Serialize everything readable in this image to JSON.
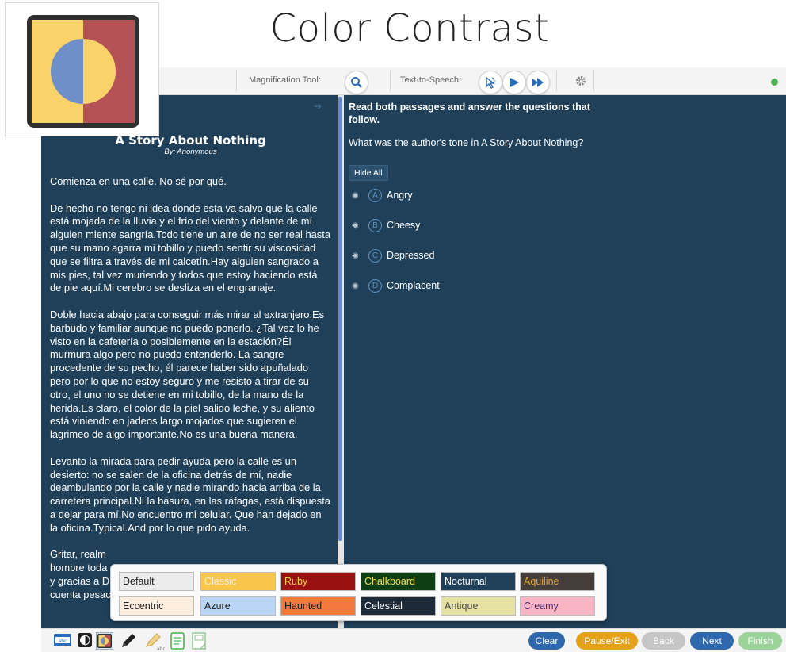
{
  "app": {
    "title": "Color Contrast"
  },
  "toolbar": {
    "magnification_label": "Magnification Tool:",
    "tts_label": "Text-to-Speech:",
    "status_color": "#4caf50"
  },
  "passage": {
    "title": "A Story About Nothing",
    "byline": "By: Anonymous",
    "paragraphs": [
      "Comienza en una calle. No sé por qué.",
      "De hecho no tengo ni idea donde esta va salvo que la calle está mojada de la lluvia y el frío del viento y delante de mí alguien miente sangría.Todo tiene un aire de no ser real hasta que su mano agarra mi tobillo y puedo sentir su viscosidad que se filtra a través de mi calcetín.Hay alguien sangrado a mis pies, tal vez muriendo y todos que estoy haciendo está de pie aquí.Mi cerebro se desliza en el engranaje.",
      "Doble hacia abajo para conseguir más mirar al extranjero.Es barbudo y familiar aunque no puedo ponerlo. ¿Tal vez lo he visto en la cafetería o posiblemente en la estación?Él murmura algo pero no puedo entenderlo. La sangre procedente de su pecho, él parece haber sido apuñalado pero por lo que no estoy seguro y me resisto a tirar de su otro, el uno no se detiene en mi tobillo, de la mano de la herida.Es claro, el color de la piel salido leche, y su aliento está viniendo en jadeos largo mojados que sugieren el lagrimeo de algo importante.No es una buena manera.",
      "Levanto la mirada para pedir ayuda pero la calle es un desierto: no se salen de la oficina detrás de mí, nadie deambulando por la calle y nadie mirando hacia arriba de la carretera principal.Ni la basura, en las ráfagas, está dispuesta a dejar para mí.No encuentro mi celular. Que han dejado en la oficina.Typical.And por lo que pido ayuda.",
      "Gritar, realm",
      "hombre toda",
      "y gracias a D",
      "cuenta pesac"
    ]
  },
  "question": {
    "heading": "Read both passages and answer the questions that follow.",
    "text": "What was the author's tone in A Story About Nothing?",
    "hide_all_label": "Hide All",
    "options": [
      {
        "letter": "A",
        "label": "Angry"
      },
      {
        "letter": "B",
        "label": "Cheesy"
      },
      {
        "letter": "C",
        "label": "Depressed"
      },
      {
        "letter": "D",
        "label": "Complacent"
      }
    ]
  },
  "palette": {
    "swatches": [
      {
        "label": "Default",
        "bg": "#ececec",
        "fg": "#222222"
      },
      {
        "label": "Classic",
        "bg": "#f7c64a",
        "fg": "#f2efe0"
      },
      {
        "label": "Ruby",
        "bg": "#9b1010",
        "fg": "#f6d34b"
      },
      {
        "label": "Chalkboard",
        "bg": "#0e3e14",
        "fg": "#f6e24b"
      },
      {
        "label": "Nocturnal",
        "bg": "#20405a",
        "fg": "#ffffff"
      },
      {
        "label": "Aquiline",
        "bg": "#453d3a",
        "fg": "#e2a536"
      },
      {
        "label": "Eccentric",
        "bg": "#fdeede",
        "fg": "#222222"
      },
      {
        "label": "Azure",
        "bg": "#bad6f6",
        "fg": "#222222"
      },
      {
        "label": "Haunted",
        "bg": "#f37a3c",
        "fg": "#1a1a1a"
      },
      {
        "label": "Celestial",
        "bg": "#1c2a3a",
        "fg": "#ffffff"
      },
      {
        "label": "Antique",
        "bg": "#e5e2a3",
        "fg": "#4b4b4b"
      },
      {
        "label": "Creamy",
        "bg": "#f8b6c4",
        "fg": "#4a2a6e"
      }
    ]
  },
  "bottom": {
    "clear_label": "Clear",
    "pause_label": "Pause/Exit",
    "back_label": "Back",
    "next_label": "Next",
    "finish_label": "Finish",
    "colors": {
      "clear": "#2f68ad",
      "pause": "#e3a21a",
      "back": "#c6c6c6",
      "next": "#2f68ad",
      "finish": "#9bd39b"
    },
    "tools": [
      "keyboard-icon",
      "contrast-icon",
      "color-contrast-icon",
      "pencil-icon",
      "highlighter-icon",
      "notepad-icon",
      "sticky-note-icon"
    ]
  }
}
